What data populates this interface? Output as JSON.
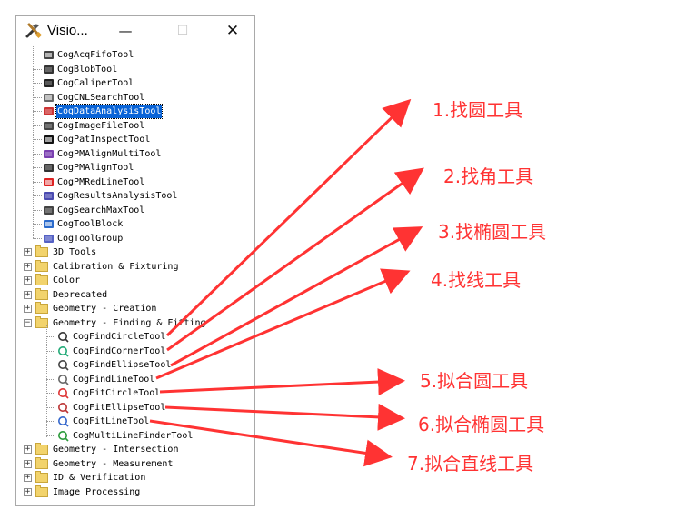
{
  "window": {
    "title": "Visio...",
    "minimize": "—",
    "maximize": "☐",
    "close": "✕"
  },
  "tree": {
    "tools": [
      "CogAcqFifoTool",
      "CogBlobTool",
      "CogCaliperTool",
      "CogCNLSearchTool",
      "CogDataAnalysisTool",
      "CogImageFileTool",
      "CogPatInspectTool",
      "CogPMAlignMultiTool",
      "CogPMAlignTool",
      "CogPMRedLineTool",
      "CogResultsAnalysisTool",
      "CogSearchMaxTool",
      "CogToolBlock",
      "CogToolGroup"
    ],
    "selected": "CogDataAnalysisTool",
    "folders_before": [
      "3D Tools",
      "Calibration & Fixturing",
      "Color",
      "Deprecated",
      "Geometry - Creation"
    ],
    "open_folder": "Geometry - Finding & Fitting",
    "children": [
      "CogFindCircleTool",
      "CogFindCornerTool",
      "CogFindEllipseTool",
      "CogFindLineTool",
      "CogFitCircleTool",
      "CogFitEllipseTool",
      "CogFitLineTool",
      "CogMultiLineFinderTool"
    ],
    "folders_after": [
      "Geometry - Intersection",
      "Geometry - Measurement",
      "ID & Verification",
      "Image Processing"
    ]
  },
  "annotations": [
    "1.找圆工具",
    "2.找角工具",
    "3.找椭圆工具",
    "4.找线工具",
    "5.拟合圆工具",
    "6.拟合椭圆工具",
    "7.拟合直线工具"
  ],
  "colors": {
    "annotation": "#ff3333",
    "selection": "#0a64d7"
  }
}
